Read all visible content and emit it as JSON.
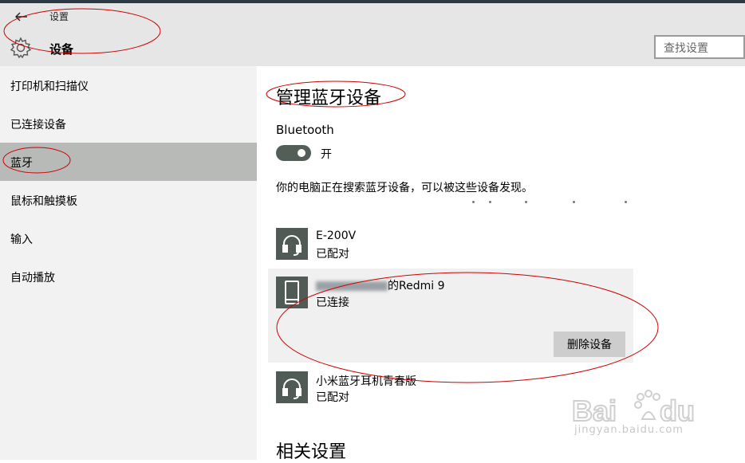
{
  "header": {
    "back_icon": "back-arrow-icon",
    "app_title": "设置",
    "page_title": "设备",
    "gear_icon": "gear-icon",
    "search_placeholder": "查找设置"
  },
  "sidebar": {
    "items": [
      {
        "label": "打印机和扫描仪",
        "active": false
      },
      {
        "label": "已连接设备",
        "active": false
      },
      {
        "label": "蓝牙",
        "active": true
      },
      {
        "label": "鼠标和触摸板",
        "active": false
      },
      {
        "label": "输入",
        "active": false
      },
      {
        "label": "自动播放",
        "active": false
      }
    ]
  },
  "main": {
    "title": "管理蓝牙设备",
    "bluetooth_label": "Bluetooth",
    "toggle_state": "开",
    "status_text": "你的电脑正在搜索蓝牙设备，可以被这些设备发现。",
    "devices": [
      {
        "name": "E-200V",
        "state": "已配对",
        "icon": "headset-icon"
      },
      {
        "name_suffix": "的Redmi 9",
        "state": "已连接",
        "icon": "phone-icon",
        "selected": true,
        "action": "删除设备"
      },
      {
        "name": "小米蓝牙耳机青春版",
        "state": "已配对",
        "icon": "headset-icon"
      }
    ],
    "related_title": "相关设置"
  },
  "watermark": {
    "text": "jingyan.baidu.com",
    "logo": "baidu-jingyan-logo"
  },
  "colors": {
    "header_bg": "#e6e6e6",
    "sidebar_bg": "#f2f2f2",
    "active_item": "#b8bab8",
    "toggle_on": "#525e56",
    "device_icon": "#4f5b54",
    "annotation": "#cc0000"
  }
}
